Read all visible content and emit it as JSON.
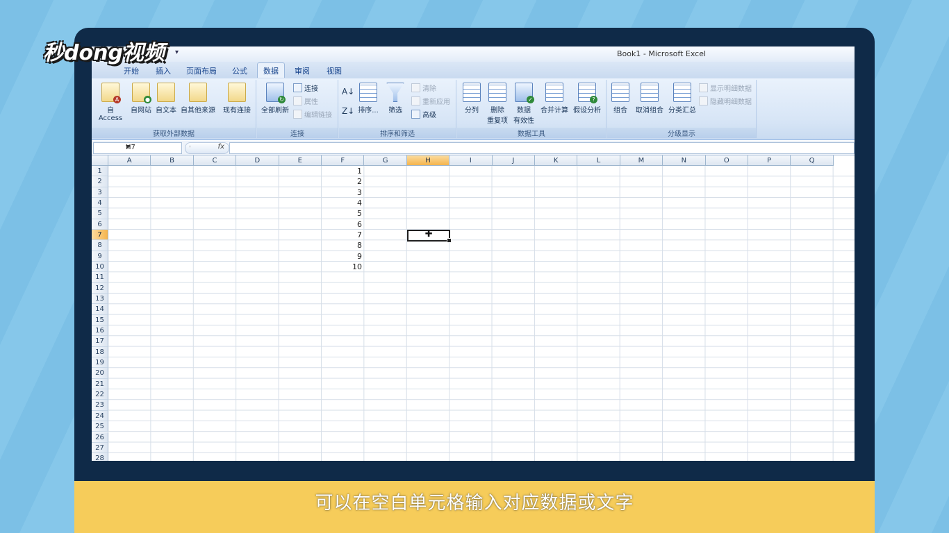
{
  "watermark": {
    "logo_text": "秒dong视频"
  },
  "caption": {
    "text": "可以在空白单元格输入对应数据或文字"
  },
  "window": {
    "title": "Book1 - Microsoft Excel",
    "qat_arrow": "▾"
  },
  "tabs": [
    {
      "label": "开始"
    },
    {
      "label": "插入"
    },
    {
      "label": "页面布局"
    },
    {
      "label": "公式"
    },
    {
      "label": "数据",
      "active": true
    },
    {
      "label": "审阅"
    },
    {
      "label": "视图"
    }
  ],
  "ribbon": {
    "groups": [
      {
        "label": "获取外部数据",
        "buttons": [
          "自 Access",
          "自网站",
          "自文本",
          "自其他来源",
          "现有连接"
        ]
      },
      {
        "label": "连接",
        "big": "全部刷新",
        "small": [
          "连接",
          "属性",
          "编辑链接"
        ]
      },
      {
        "label": "排序和筛选",
        "sort": "排序...",
        "filter": "筛选",
        "small": [
          "清除",
          "重新应用",
          "高级"
        ]
      },
      {
        "label": "数据工具",
        "buttons": [
          "分列",
          "删除",
          "重复项",
          "数据",
          "有效性",
          "合并计算",
          "假设分析"
        ]
      },
      {
        "label": "分级显示",
        "buttons": [
          "组合",
          "取消组合",
          "分类汇总"
        ],
        "small": [
          "显示明细数据",
          "隐藏明细数据"
        ]
      }
    ]
  },
  "formula_bar": {
    "name_box": "H7",
    "fx": "fx",
    "value": ""
  },
  "sheet": {
    "columns": [
      "A",
      "B",
      "C",
      "D",
      "E",
      "F",
      "G",
      "H",
      "I",
      "J",
      "K",
      "L",
      "M",
      "N",
      "O",
      "P",
      "Q"
    ],
    "rows": [
      "1",
      "2",
      "3",
      "4",
      "5",
      "6",
      "7",
      "8",
      "9",
      "10",
      "11",
      "12",
      "13",
      "14",
      "15",
      "16",
      "17",
      "18",
      "19",
      "20",
      "21",
      "22",
      "23",
      "24",
      "25",
      "26",
      "27",
      "28"
    ],
    "selected_column": "H",
    "selected_row": "7",
    "column_F_values": [
      "1",
      "2",
      "3",
      "4",
      "5",
      "6",
      "7",
      "8",
      "9",
      "10"
    ]
  },
  "colors": {
    "accent_selected_header": "#f5b44c",
    "caption_bar": "#f6cc5a",
    "frame": "#0f2a48"
  }
}
